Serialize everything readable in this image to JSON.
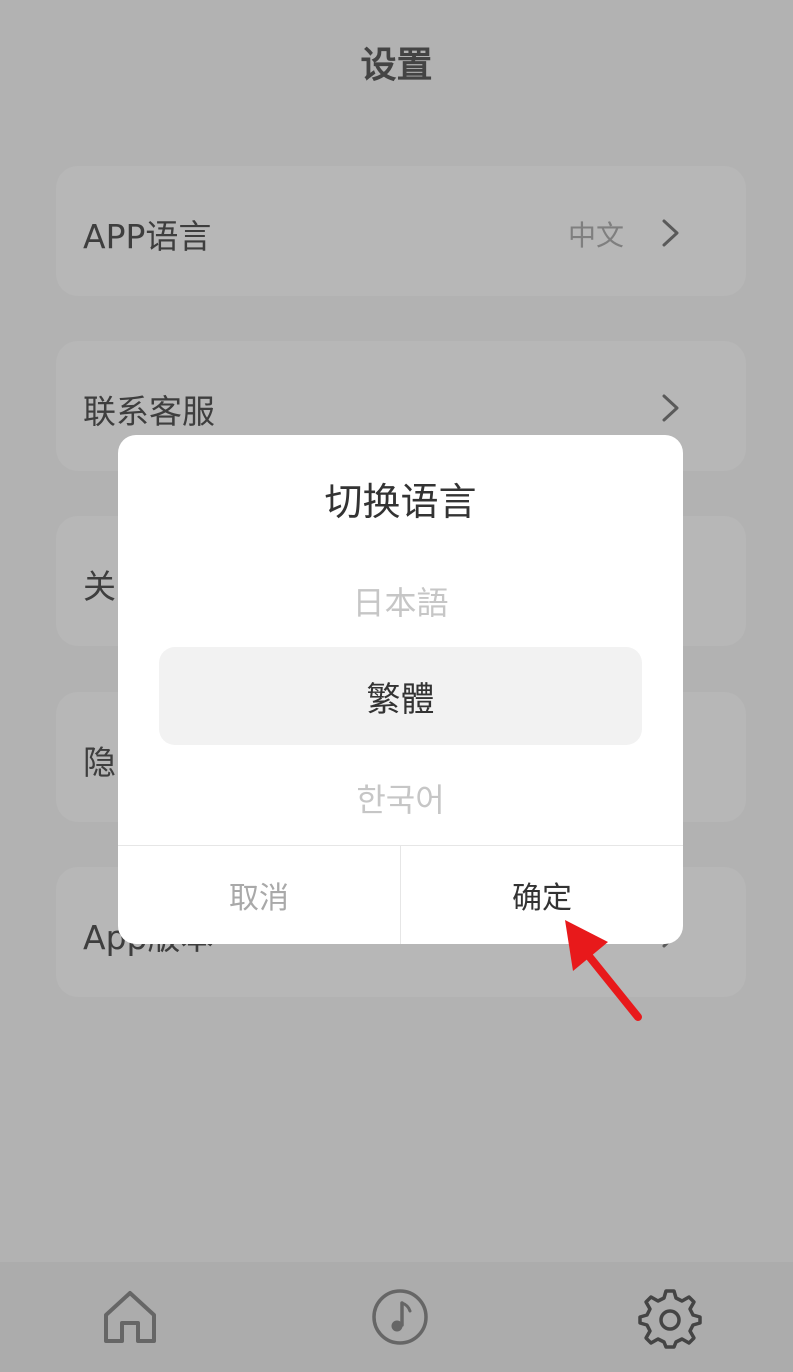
{
  "header": {
    "title": "设置"
  },
  "settings": {
    "items": [
      {
        "label": "APP语言",
        "value": "中文"
      },
      {
        "label": "联系客服"
      },
      {
        "label": "关"
      },
      {
        "label": "隐"
      },
      {
        "label": "App版本"
      }
    ]
  },
  "dialog": {
    "title": "切换语言",
    "options": [
      "日本語",
      "繁體",
      "한국어"
    ],
    "selected_index": 1,
    "cancel_label": "取消",
    "confirm_label": "确定"
  },
  "tabbar": {
    "tabs": [
      {
        "icon": "home-icon"
      },
      {
        "icon": "music-note-icon"
      },
      {
        "icon": "gear-icon",
        "active": true
      }
    ]
  },
  "annotation": {
    "arrow_color": "#e8191b"
  }
}
